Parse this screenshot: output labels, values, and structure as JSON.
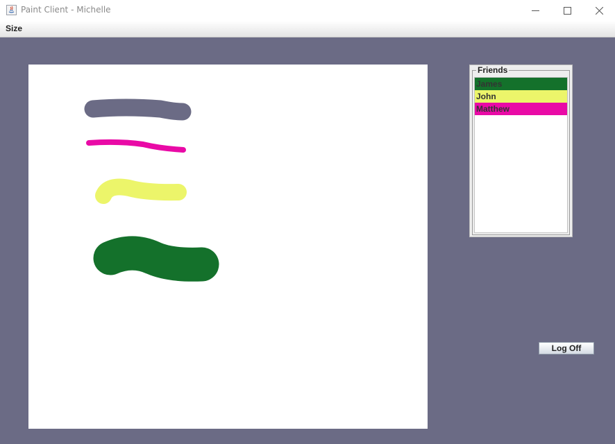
{
  "window": {
    "title": "Paint Client - Michelle",
    "icon": "java-icon",
    "controls": [
      "minimize-icon",
      "maximize-icon",
      "close-icon"
    ]
  },
  "menubar": {
    "items": [
      "Size"
    ]
  },
  "friends": {
    "legend": "Friends",
    "items": [
      {
        "name": "James",
        "color": "#14712b"
      },
      {
        "name": "John",
        "color": "#ecf56a"
      },
      {
        "name": "Matthew",
        "color": "#e90aa6"
      }
    ]
  },
  "buttons": {
    "log_off": "Log Off"
  },
  "canvas": {
    "strokes": [
      {
        "color": "#6b6b85"
      },
      {
        "color": "#e90aa6"
      },
      {
        "color": "#ecf56a"
      },
      {
        "color": "#14712b"
      }
    ]
  },
  "colors": {
    "background": "#6b6b85",
    "canvas": "#ffffff"
  }
}
